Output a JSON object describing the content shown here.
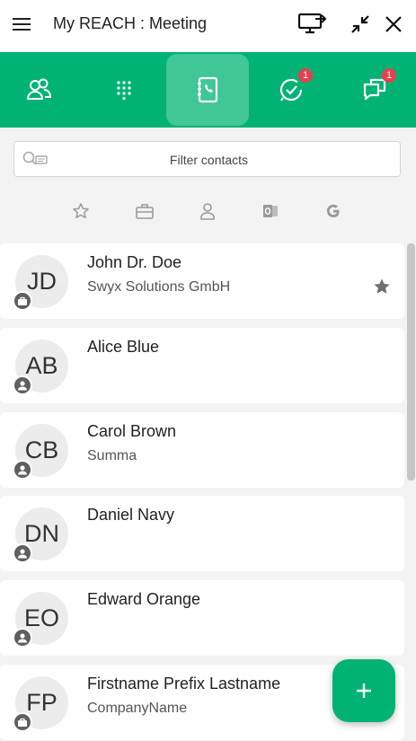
{
  "app": {
    "title": "My REACH : Meeting"
  },
  "colors": {
    "brand": "#00b374",
    "badge": "#e5404f",
    "avatar_bg": "#ececec"
  },
  "titlebar": {
    "icons": [
      "menu-icon",
      "screen-share-icon",
      "minimize-icon",
      "close-icon"
    ]
  },
  "tabs": [
    {
      "name": "contacts-favorites",
      "icon": "users-icon",
      "badge": ""
    },
    {
      "name": "dialpad",
      "icon": "dialpad-icon",
      "badge": ""
    },
    {
      "name": "phonebook",
      "icon": "phonebook-icon",
      "badge": "",
      "active": true
    },
    {
      "name": "call-history",
      "icon": "call-history-icon",
      "badge": "1"
    },
    {
      "name": "messages",
      "icon": "messages-icon",
      "badge": "1"
    }
  ],
  "filter": {
    "placeholder": "Filter contacts"
  },
  "sources": [
    "favorites-star-icon",
    "business-briefcase-icon",
    "personal-person-icon",
    "outlook-icon",
    "google-icon"
  ],
  "contacts": [
    {
      "initials": "JD",
      "name": "John Dr. Doe",
      "company": "Swyx Solutions GmbH",
      "type": "business",
      "favorite": true
    },
    {
      "initials": "AB",
      "name": "Alice Blue",
      "company": "",
      "type": "personal",
      "favorite": false
    },
    {
      "initials": "CB",
      "name": "Carol Brown",
      "company": "Summa",
      "type": "personal",
      "favorite": false
    },
    {
      "initials": "DN",
      "name": "Daniel Navy",
      "company": "",
      "type": "personal",
      "favorite": false
    },
    {
      "initials": "EO",
      "name": "Edward Orange",
      "company": "",
      "type": "personal",
      "favorite": false
    },
    {
      "initials": "FP",
      "name": "Firstname Prefix Lastname",
      "company": "CompanyName",
      "type": "business",
      "favorite": false
    }
  ],
  "fab": {
    "icon": "add-icon"
  }
}
